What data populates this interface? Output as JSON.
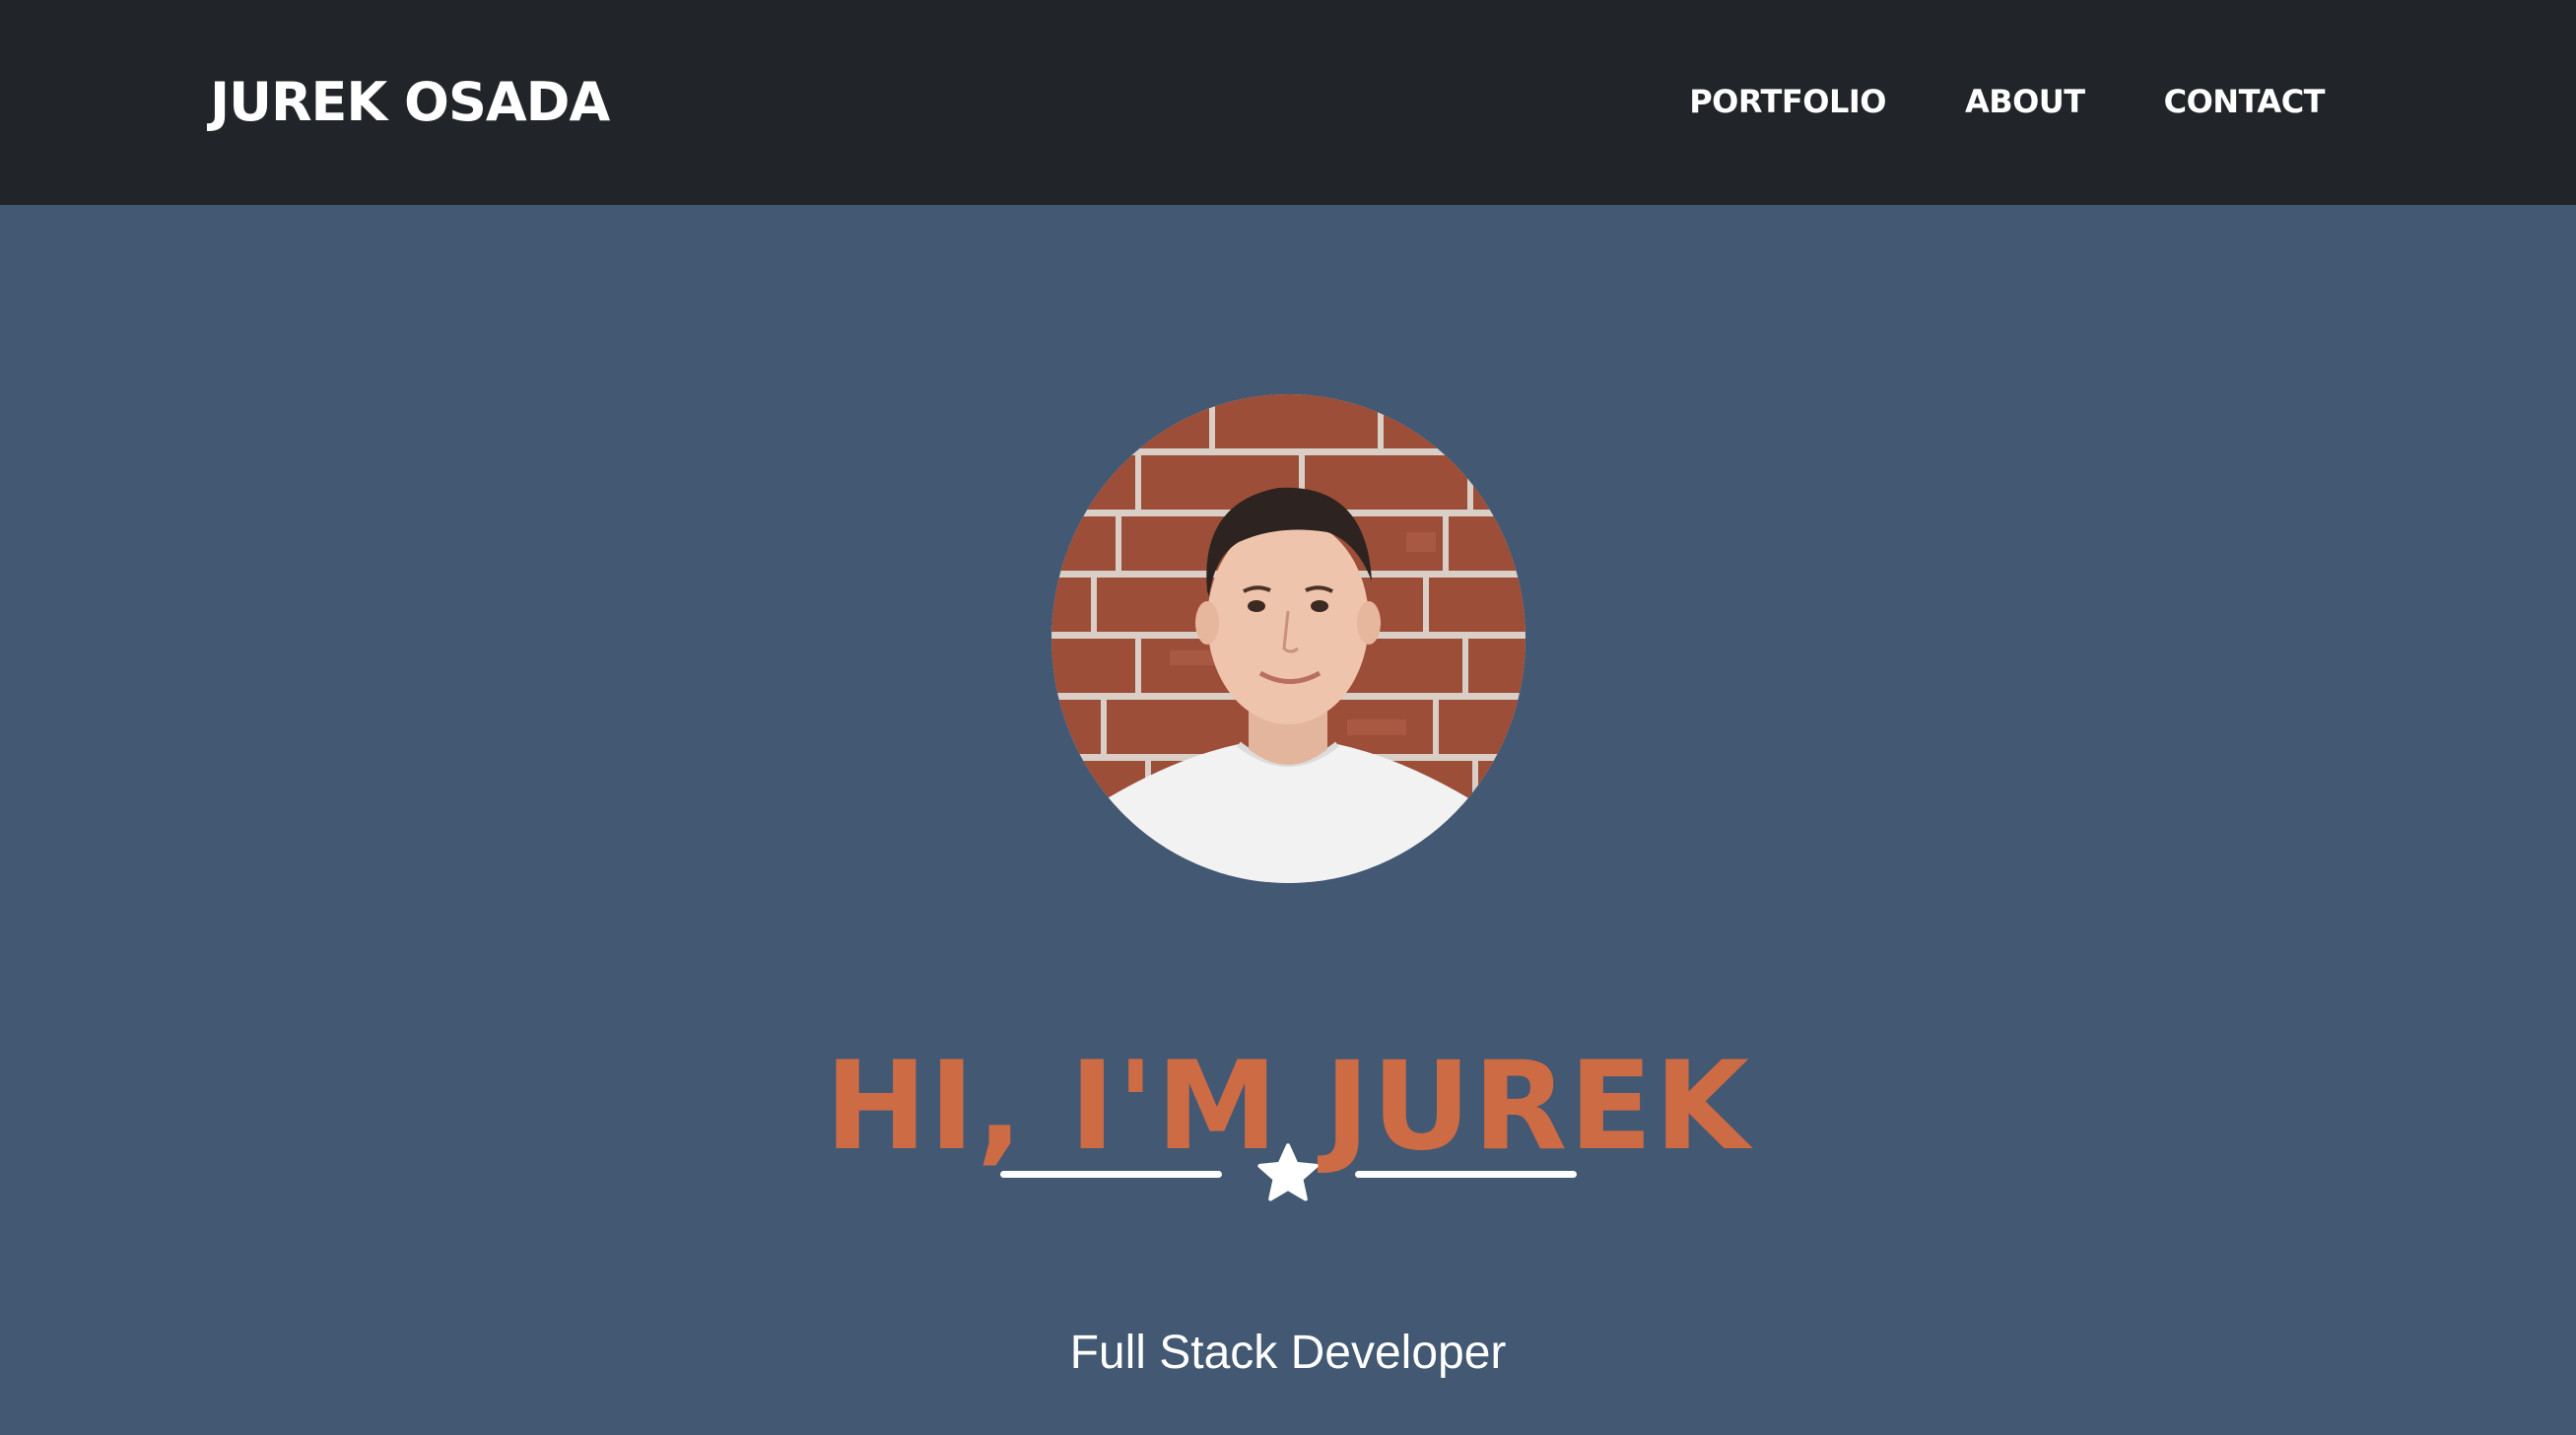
{
  "navbar": {
    "brand": "JUREK OSADA",
    "links": [
      {
        "label": "PORTFOLIO"
      },
      {
        "label": "ABOUT"
      },
      {
        "label": "CONTACT"
      }
    ]
  },
  "masthead": {
    "avatar_icon": "profile-photo",
    "headline": "HI, I'M JUREK",
    "divider_icon": "star-icon",
    "subheading": "Full Stack Developer"
  },
  "colors": {
    "navbar_bg": "#212529",
    "page_bg": "#425873",
    "headline": "#cd6b45",
    "text": "#ffffff"
  }
}
